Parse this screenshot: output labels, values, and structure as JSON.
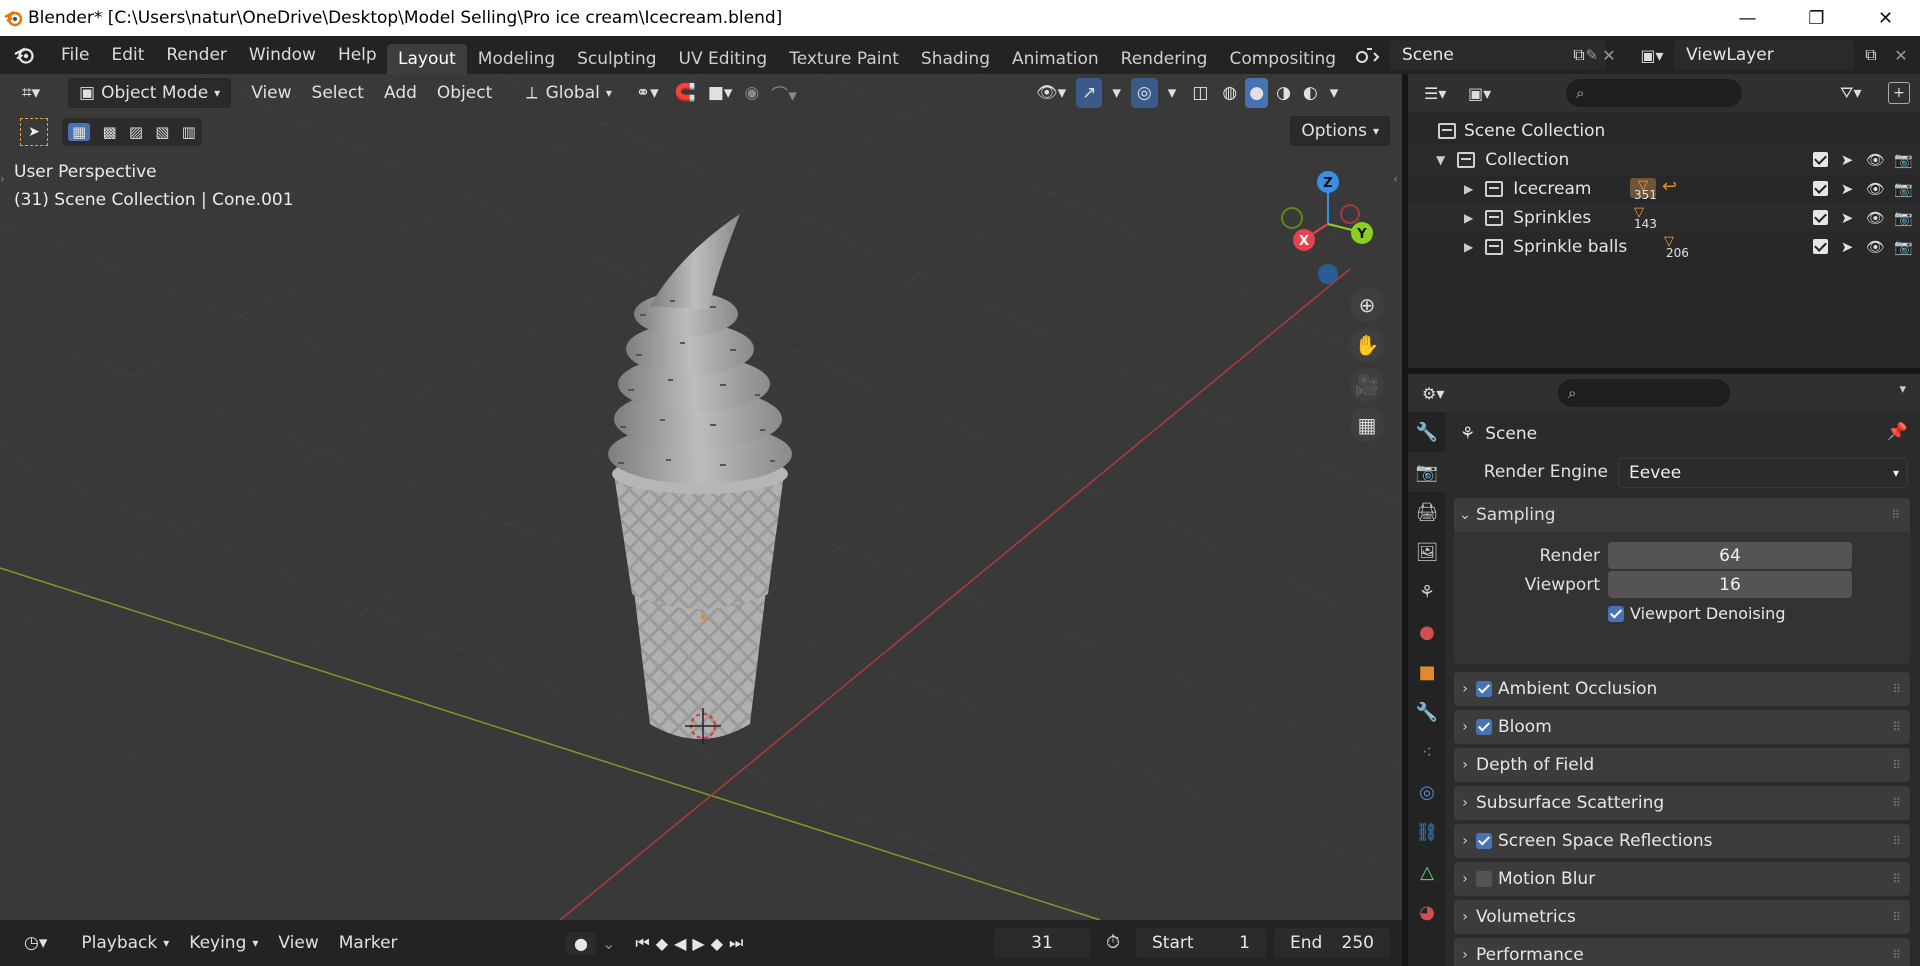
{
  "titlebar": {
    "title": "Blender* [C:\\Users\\natur\\OneDrive\\Desktop\\Model Selling\\Pro ice cream\\Icecream.blend]",
    "minimize": "—",
    "restore": "❐",
    "close": "✕"
  },
  "menu": {
    "items": [
      "File",
      "Edit",
      "Render",
      "Window",
      "Help"
    ]
  },
  "workspaces": {
    "tabs": [
      "Layout",
      "Modeling",
      "Sculpting",
      "UV Editing",
      "Texture Paint",
      "Shading",
      "Animation",
      "Rendering",
      "Compositing"
    ],
    "active": "Layout"
  },
  "scene": {
    "name": "Scene"
  },
  "viewlayer": {
    "name": "ViewLayer"
  },
  "viewport": {
    "mode": "Object Mode",
    "menus": [
      "View",
      "Select",
      "Add",
      "Object"
    ],
    "orientation": "Global",
    "options_label": "Options",
    "perspective": "User Perspective",
    "context": "(31) Scene Collection | Cone.001",
    "gizmo": {
      "z": "Z",
      "x": "X",
      "y": "Y"
    }
  },
  "outliner": {
    "root": "Scene Collection",
    "collection": "Collection",
    "children": [
      {
        "name": "Icecream",
        "count": "351"
      },
      {
        "name": "Sprinkles",
        "count": "143"
      },
      {
        "name": "Sprinkle balls",
        "count": "206"
      }
    ]
  },
  "properties": {
    "context": "Scene",
    "render_engine_label": "Render Engine",
    "render_engine": "Eevee",
    "sampling": {
      "title": "Sampling",
      "render_label": "Render",
      "render_value": "64",
      "viewport_label": "Viewport",
      "viewport_value": "16",
      "denoising_label": "Viewport Denoising"
    },
    "panels": [
      {
        "label": "Ambient Occlusion",
        "checkbox": true
      },
      {
        "label": "Bloom",
        "checkbox": true
      },
      {
        "label": "Depth of Field",
        "checkbox": null
      },
      {
        "label": "Subsurface Scattering",
        "checkbox": null
      },
      {
        "label": "Screen Space Reflections",
        "checkbox": true
      },
      {
        "label": "Motion Blur",
        "checkbox": false
      },
      {
        "label": "Volumetrics",
        "checkbox": null
      },
      {
        "label": "Performance",
        "checkbox": null
      }
    ]
  },
  "timeline": {
    "menus": [
      "Playback",
      "Keying",
      "View",
      "Marker"
    ],
    "current_frame": "31",
    "start_label": "Start",
    "start_value": "1",
    "end_label": "End",
    "end_value": "250"
  },
  "colors": {
    "accent": "#4772b3",
    "axis_x": "#e8424e",
    "axis_y": "#8bd01f",
    "axis_z": "#3a8ee6",
    "viewport_bg": "#393939"
  }
}
